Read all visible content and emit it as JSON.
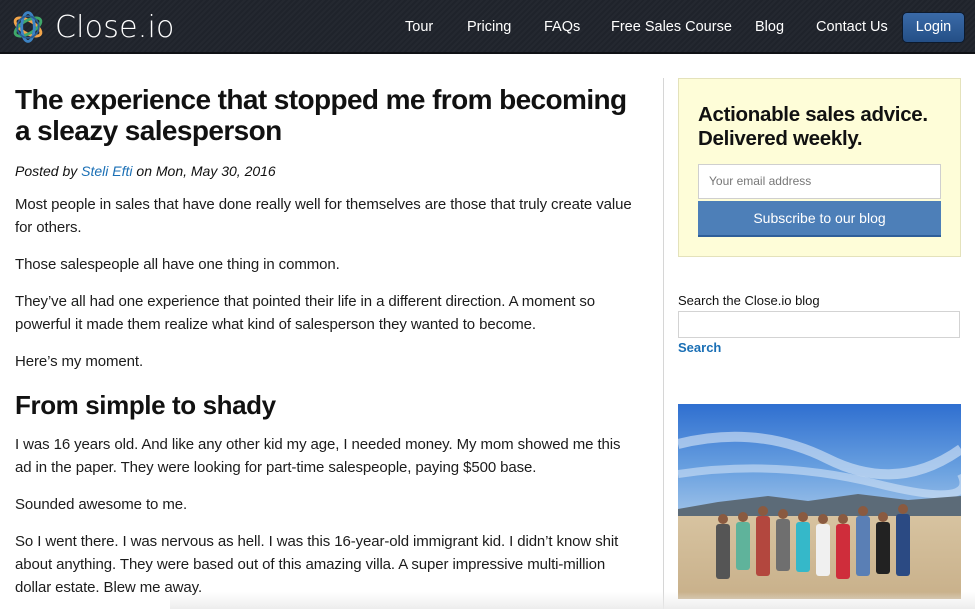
{
  "brand": {
    "name": "Close.io",
    "logo_icon": "atom-rings-logo-icon"
  },
  "nav": {
    "items": [
      "Tour",
      "Pricing",
      "FAQs",
      "Free Sales Course",
      "Blog",
      "Contact Us"
    ],
    "login_label": "Login"
  },
  "article": {
    "title": "The experience that stopped me from becoming a sleazy salesperson",
    "byline": {
      "prefix": "Posted by",
      "author": "Steli Efti",
      "suffix": "on Mon, May 30, 2016"
    },
    "paragraphs_intro": [
      "Most people in sales that have done really well for themselves are those that truly create value for others.",
      "Those salespeople all have one thing in common.",
      "They’ve all had one experience that pointed their life in a different direction. A moment so powerful it made them realize what kind of salesperson they wanted to become.",
      "Here’s my moment."
    ],
    "section_heading": "From simple to shady",
    "paragraphs_section": [
      "I was 16 years old. And like any other kid my age, I needed money. My mom showed me this ad in the paper. They were looking for part-time salespeople, paying $500 base.",
      "Sounded awesome to me.",
      "So I went there. I was nervous as hell. I was this 16-year-old immigrant kid. I didn’t know shit about anything. They were based out of this amazing villa. A super impressive multi-million dollar estate. Blew me away."
    ]
  },
  "sidebar": {
    "signup": {
      "title_line1": "Actionable sales advice.",
      "title_line2": "Delivered weekly.",
      "email_placeholder": "Your email address",
      "subscribe_label": "Subscribe to our blog",
      "background_color": "#fefdd8",
      "button_color": "#4d7fb8"
    },
    "search": {
      "label": "Search the Close.io blog",
      "input_value": "",
      "link_label": "Search"
    },
    "photo": {
      "description": "Team photo of eleven people standing on a sandy beach under a blue sky with hills behind"
    }
  },
  "colors": {
    "navbar": "#1f232b",
    "link": "#1a6fb5",
    "login_button": "#2f5d97"
  }
}
